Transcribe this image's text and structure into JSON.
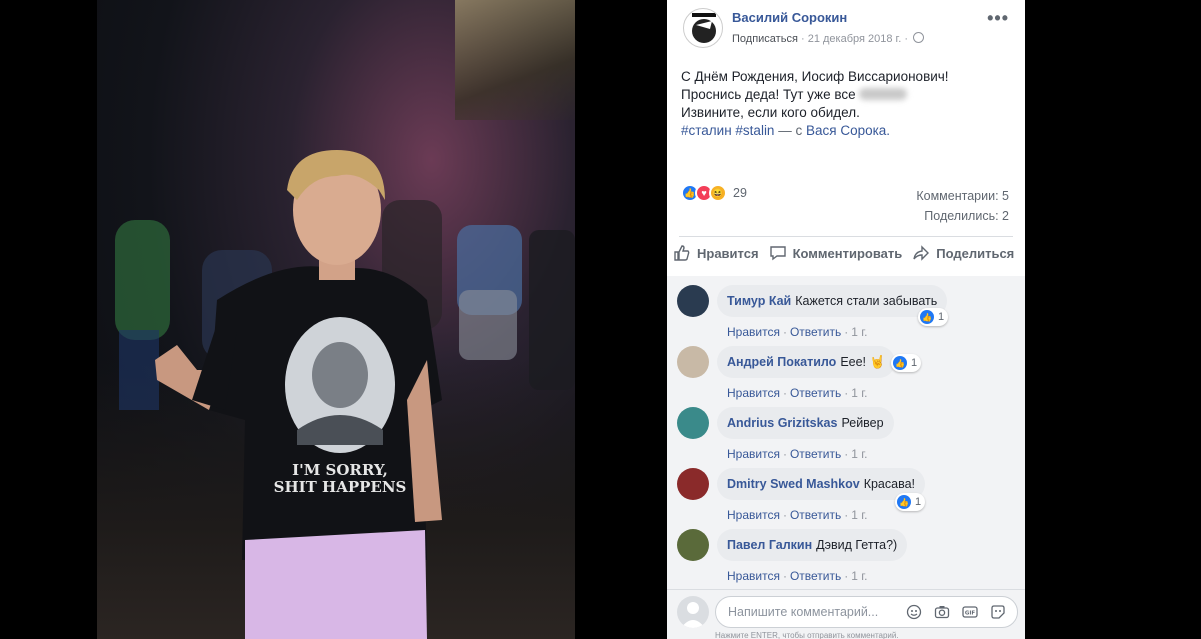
{
  "post": {
    "author": "Василий Сорокин",
    "subscribe": "Подписаться",
    "date": "21 декабря 2018 г.",
    "more": "•••",
    "lines": [
      "С Днём Рождения, Иосиф Виссарионович!",
      "Проснись деда! Тут уже все",
      "Извините, если кого обидел."
    ],
    "hashtags": "#сталин #stalin",
    "with_sep": "— с",
    "tagged": "Вася Сорока.",
    "reaction_count": "29",
    "comments_stat": "Комментарии: 5",
    "shares_stat": "Поделились: 2"
  },
  "actions": {
    "like": "Нравится",
    "comment": "Комментировать",
    "share": "Поделиться"
  },
  "comments": [
    {
      "name": "Тимур Кай",
      "text": "Кажется стали забывать",
      "like": "Нравится",
      "reply": "Ответить",
      "time": "1 г.",
      "likes": "1"
    },
    {
      "name": "Андрей Покатило",
      "text": "Еее! 🤘",
      "like": "Нравится",
      "reply": "Ответить",
      "time": "1 г.",
      "likes": "1"
    },
    {
      "name": "Andrius Grizitskas",
      "text": "Рейвер",
      "like": "Нравится",
      "reply": "Ответить",
      "time": "1 г.",
      "likes": null
    },
    {
      "name": "Dmitry Swed Mashkov",
      "text": "Красава!",
      "like": "Нравится",
      "reply": "Ответить",
      "time": "1 г.",
      "likes": "1"
    },
    {
      "name": "Павел Галкин",
      "text": "Дэвид Гетта?)",
      "like": "Нравится",
      "reply": "Ответить",
      "time": "1 г.",
      "likes": null
    }
  ],
  "composer": {
    "placeholder": "Напишите комментарий...",
    "hint": "Нажмите ENTER, чтобы отправить комментарий."
  },
  "colors": {
    "link": "#385898",
    "like_blue": "#2078f4",
    "love_red": "#f33e58"
  },
  "photo": {
    "shirt_text_1": "I'M SORRY,",
    "shirt_text_2": "SHIT HAPPENS"
  }
}
